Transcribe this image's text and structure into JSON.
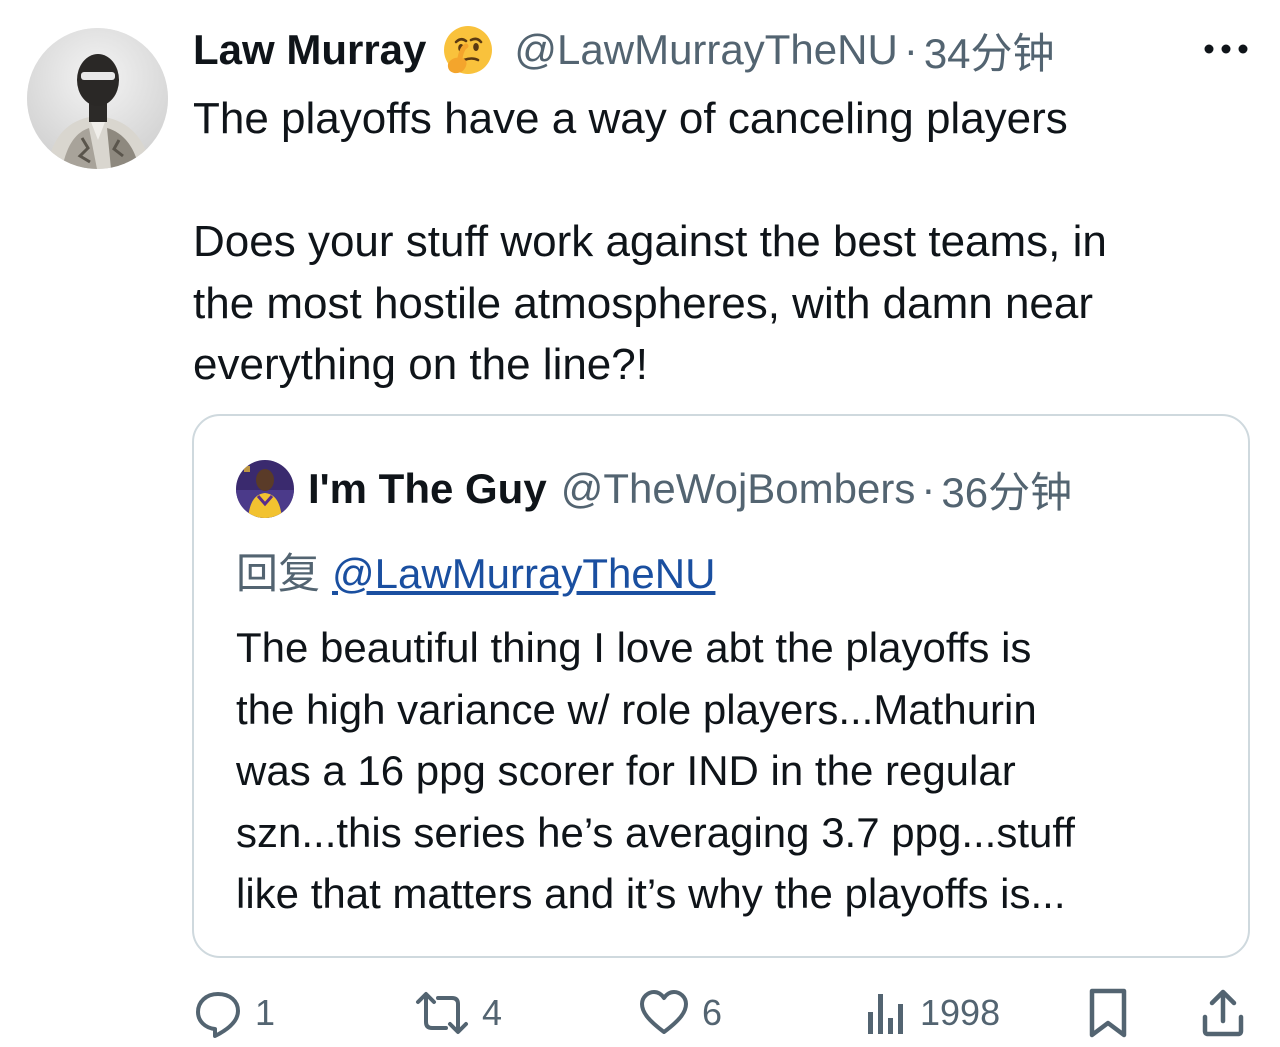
{
  "tweet": {
    "author_name": "Law Murray",
    "author_emoji": "🤔",
    "author_handle": "@LawMurrayTheNU",
    "separator": "·",
    "time": "34分钟",
    "text_lines": [
      "The playoffs have a way of canceling players",
      "",
      "Does your stuff work against the best teams, in",
      "the most hostile atmospheres, with damn near",
      "everything on the line?!"
    ]
  },
  "quoted": {
    "author_name": "I'm The Guy",
    "author_handle": "@TheWojBombers",
    "separator": "·",
    "time": "36分钟",
    "reply_prefix": "回复",
    "reply_to": "@LawMurrayTheNU",
    "text_lines": [
      "The beautiful thing I love abt the playoffs is",
      "the high variance w/ role players...Mathurin",
      "was a 16 ppg scorer for IND in the regular",
      "szn...this series he’s averaging 3.7 ppg...stuff",
      "like that matters and it’s why the playoffs is..."
    ]
  },
  "actions": {
    "replies": "1",
    "retweets": "4",
    "likes": "6",
    "views": "1998"
  },
  "colors": {
    "text": "#0f1419",
    "secondary": "#536471",
    "border": "#cfd9de",
    "link": "#1a4fa0"
  },
  "icons": [
    "avatar",
    "thinking-face-emoji",
    "more-icon",
    "reply-icon",
    "retweet-icon",
    "like-icon",
    "views-icon",
    "bookmark-icon",
    "share-icon"
  ]
}
